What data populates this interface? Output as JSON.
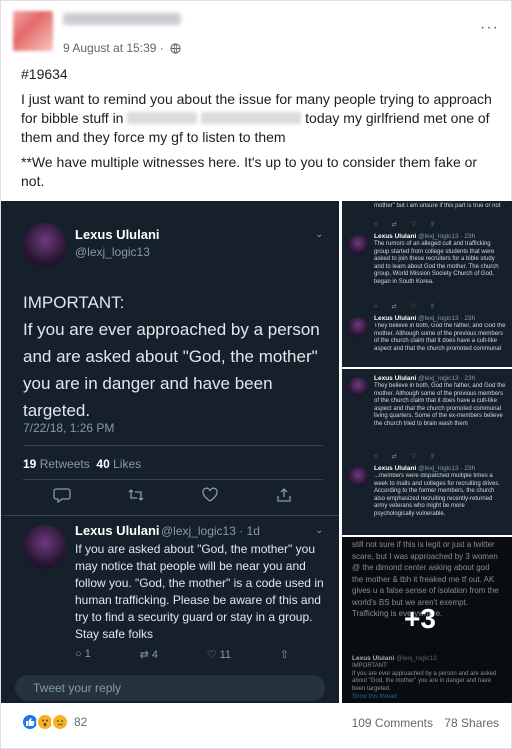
{
  "post": {
    "timestamp": "9 August at 15:39",
    "more_label": "···",
    "text": {
      "p1_before": "#19634",
      "p2_start": "I just want to remind you about the issue for many people trying to approach for bibble stuff in ",
      "p2_end": " today my girlfriend met one of them and they force my gf to listen to them",
      "p3": "**We have multiple witnesses here. It's up to you to consider them fake or not."
    }
  },
  "tweet_main": {
    "name": "Lexus Ululani",
    "handle": "@lexj_logic13",
    "body": "IMPORTANT:\nIf you are ever approached by a person and are asked about \"God, the mother\" you are in danger and  have been targeted.",
    "date": "7/22/18, 1:26 PM",
    "retweets": "19",
    "retweets_label": "Retweets",
    "likes": "40",
    "likes_label": "Likes"
  },
  "tweet_reply": {
    "name": "Lexus Ululani",
    "handle": "@lexj_logic13 · 1d",
    "body": "If you are asked about \"God, the mother\" you may notice that people will be near you and follow you. \"God, the mother\" is a code used in human trafficking. Please be aware of this and try to find a security guard or stay in a group. Stay safe folks",
    "reply_count": "1",
    "retweet_count": "4",
    "like_count": "11",
    "reply_placeholder": "Tweet your reply"
  },
  "thumb_a": {
    "top_text": "mother\" but i am unsure if this part is true or not",
    "t1_name": "Lexus Ululani",
    "t1_handle": "@lexj_logic13 · 23h",
    "t1_body": "The rumors of an alleged cult and trafficking group started from college students that were asked to join these recruiters for a bible study and to learn about God the mother. The church group, World Mission Society Church of God, began in South Korea.",
    "t2_name": "Lexus Ululani",
    "t2_handle": "@lexj_logic13 · 23h",
    "t2_body": "They believe in both, God the father, and God the mother. Although some of the previous members of the church claim that it does have a cult-like aspect and that the church promoted communal"
  },
  "thumb_b": {
    "t1_name": "Lexus Ululani",
    "t1_handle": "@lexj_logic13 · 23h",
    "t1_body": "They believe in both, God the father, and God the mother. Although some of the previous members of the church claim that it does have a cult-like aspect and that the church promoted communal living quarters. Some of the ex-members believe the church tried to brain wash them",
    "t2_name": "Lexus Ululani",
    "t2_handle": "@lexj_logic13 · 23h",
    "t2_body": "...members were dispatched multiple times a week to malls and colleges for recruiting drives. According to the former members, the church also emphasized recruiting recently-returned army veterans who might be more psychologically vulnerable."
  },
  "thumb_c": {
    "top_text": "still not sure if this is legit or just a twitter scare, but I was approached by 3 women @ the dimond center asking about god the mother & tbh it freaked me tf out. AK gives u a false sense of isolation from the world's BS but we aren't exempt. Trafficking is everywhere.",
    "mini_name": "Lexus Ululani",
    "mini_handle": "@lexj_logic13",
    "mini_body": "IMPORTANT:\nIf you are ever approached by a person and are asked about \"God, the mother\" you are in danger and  have been targeted.",
    "show_thread": "Show this thread",
    "more_count": "+3"
  },
  "footer": {
    "reaction_count": "82",
    "comments": "109 Comments",
    "shares": "78 Shares"
  },
  "colors": {
    "facebook_blue": "#1877f2",
    "twitter_dark": "#15202b",
    "twitter_muted": "#8899a6"
  },
  "icons": [
    "more-icon",
    "globe-icon",
    "reply-icon",
    "retweet-icon",
    "like-heart-icon",
    "share-icon",
    "like-reaction-icon",
    "wow-reaction-icon",
    "sad-reaction-icon"
  ]
}
